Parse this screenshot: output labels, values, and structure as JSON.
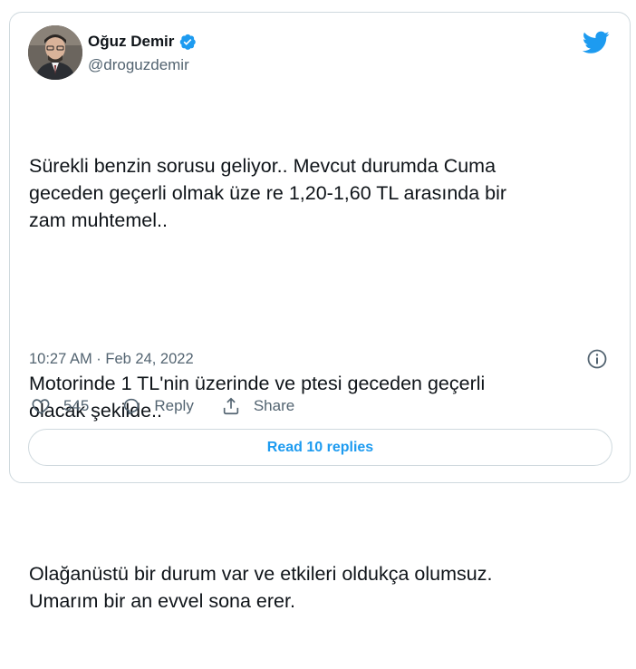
{
  "author": {
    "name": "Oğuz Demir",
    "handle": "@droguzdemir"
  },
  "tweet": {
    "paragraphs": [
      "Sürekli benzin sorusu geliyor.. Mevcut durumda Cuma\ngeceden geçerli olmak üze re 1,20-1,60 TL arasında bir\nzam muhtemel..",
      "Motorinde 1 TL'nin üzerinde ve ptesi geceden geçerli\nolacak şekilde..",
      "Olağanüstü bir durum var ve etkileri oldukça olumsuz.\nUmarım bir an evvel sona erer."
    ],
    "timestamp": "10:27 AM · Feb 24, 2022"
  },
  "actions": {
    "like_count": "545",
    "reply_label": "Reply",
    "share_label": "Share"
  },
  "read_replies_label": "Read 10 replies",
  "icons": {
    "brand": "twitter-bird-icon",
    "verified": "verified-badge-icon",
    "info": "info-icon",
    "like": "heart-icon",
    "reply": "reply-bubble-icon",
    "share": "share-icon"
  },
  "colors": {
    "accent": "#1d9bf0",
    "text": "#0f1419",
    "secondary": "#536471",
    "border": "#cfd9de"
  }
}
